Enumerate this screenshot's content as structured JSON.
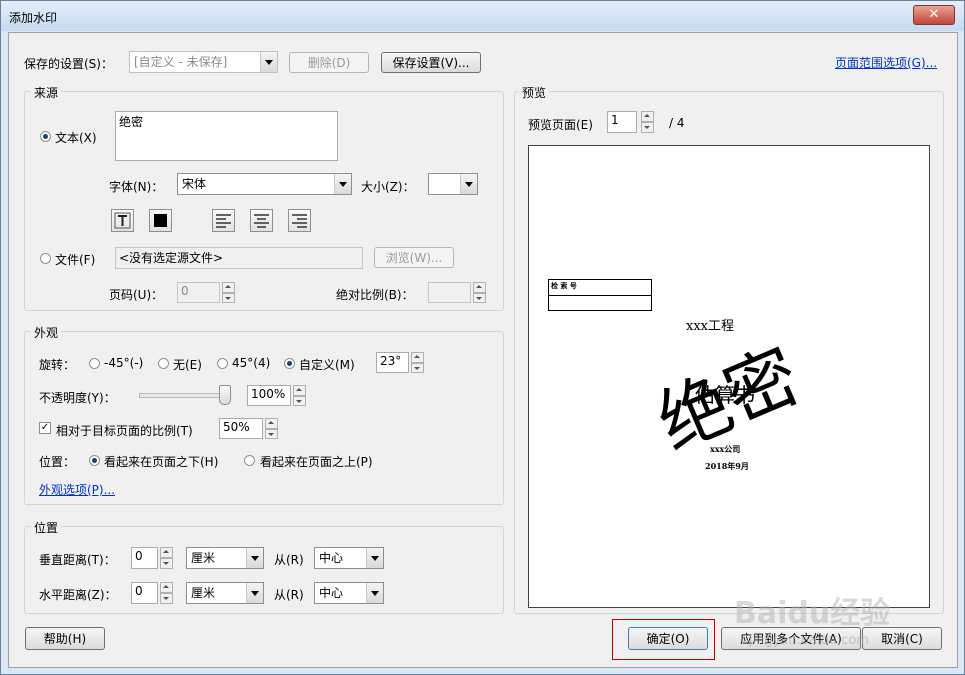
{
  "window": {
    "title": "添加水印",
    "close": "✕"
  },
  "top": {
    "saved_label": "保存的设置(S)：",
    "saved_value": "[自定义 - 未保存]",
    "delete": "删除(D)",
    "save_settings": "保存设置(V)...",
    "page_range": "页面范围选项(G)..."
  },
  "source": {
    "title": "来源",
    "text_radio": "文本(X)",
    "text_value": "绝密",
    "font_label": "字体(N)：",
    "font_value": "宋体",
    "size_label": "大小(Z)：",
    "size_value": "",
    "file_radio": "文件(F)",
    "file_value": "<没有选定源文件>",
    "browse": "浏览(W)...",
    "page_label": "页码(U)：",
    "page_value": "0",
    "abs_scale_label": "绝对比例(B)：",
    "abs_scale_value": ""
  },
  "appearance": {
    "title": "外观",
    "rotation_label": "旋转：",
    "rot_m45": "-45°(-)",
    "rot_none": "无(E)",
    "rot_45": "45°(4)",
    "rot_custom": "自定义(M)",
    "rot_value": "23°",
    "opacity_label": "不透明度(Y)：",
    "opacity_value": "100%",
    "opacity_fraction": 1.0,
    "relative_label": "相对于目标页面的比例(T)",
    "relative_value": "50%",
    "position_label": "位置：",
    "pos_behind": "看起来在页面之下(H)",
    "pos_front": "看起来在页面之上(P)",
    "options_link": "外观选项(P)..."
  },
  "position": {
    "title": "位置",
    "vertical_label": "垂直距离(T)：",
    "vertical_value": "0",
    "vertical_unit": "厘米",
    "from_label": "从(R)",
    "vertical_from": "中心",
    "horizontal_label": "水平距离(Z)：",
    "horizontal_value": "0",
    "horizontal_unit": "厘米",
    "horizontal_from": "中心"
  },
  "preview": {
    "title": "预览",
    "page_label": "预览页面(E)",
    "page_value": "1",
    "page_total": "/ 4",
    "doc_table_label": "检 索 号",
    "doc_project": "xxx工程",
    "doc_heading": "估算书",
    "watermark": "绝密",
    "doc_company": "xxx公司",
    "doc_date": "2018年9月"
  },
  "buttons": {
    "help": "帮助(H)",
    "ok": "确定(O)",
    "apply_multi": "应用到多个文件(A)",
    "cancel": "取消(C)"
  },
  "overlay": {
    "watermark_brand": "Baidu经验",
    "watermark_url": "jingyan.baidu.com"
  },
  "colors": {
    "highlight_box": "#cc0000",
    "link": "#0033cc"
  }
}
